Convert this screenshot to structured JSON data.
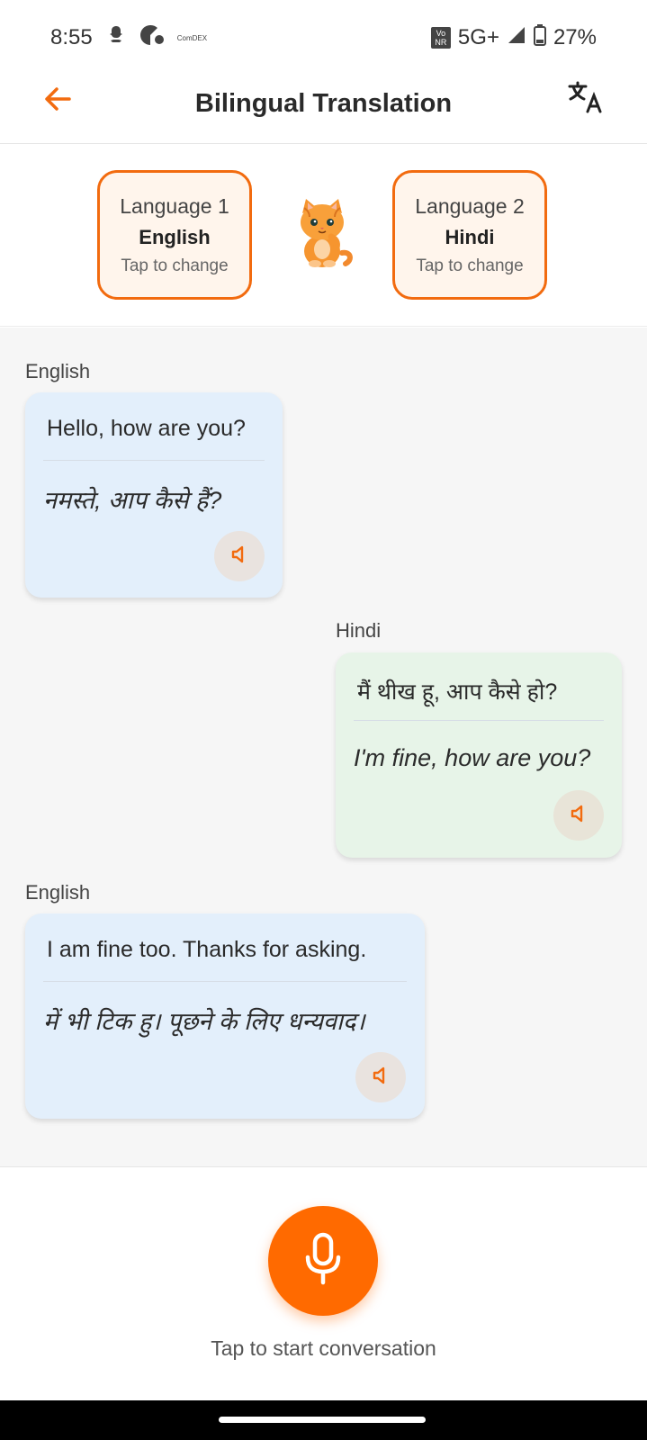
{
  "status_bar": {
    "time": "8:55",
    "app_tiny": "ComDEX",
    "vonr": "Vo NR",
    "network": "5G+",
    "battery": "27%"
  },
  "header": {
    "title": "Bilingual Translation",
    "back_icon": "arrow-left-icon",
    "translate_icon": "translate-icon"
  },
  "languages": {
    "one": {
      "label": "Language 1",
      "value": "English",
      "hint": "Tap to change"
    },
    "two": {
      "label": "Language 2",
      "value": "Hindi",
      "hint": "Tap to change"
    }
  },
  "messages": [
    {
      "speaker": "English",
      "original": "Hello, how are you?",
      "translation": "नमस्ते, आप कैसे हैं?"
    },
    {
      "speaker": "Hindi",
      "original": "मैं थीख हू, आप कैसे हो?",
      "translation": "I'm fine, how are you?"
    },
    {
      "speaker": "English",
      "original": "I am fine too. Thanks for asking.",
      "translation": "में भी टिक हु। पूछने के लिए धन्यवाद।"
    }
  ],
  "footer": {
    "mic_hint": "Tap to start conversation"
  },
  "colors": {
    "accent": "#ff6a00",
    "english_bubble": "#e3effb",
    "hindi_bubble": "#e7f4e8"
  }
}
